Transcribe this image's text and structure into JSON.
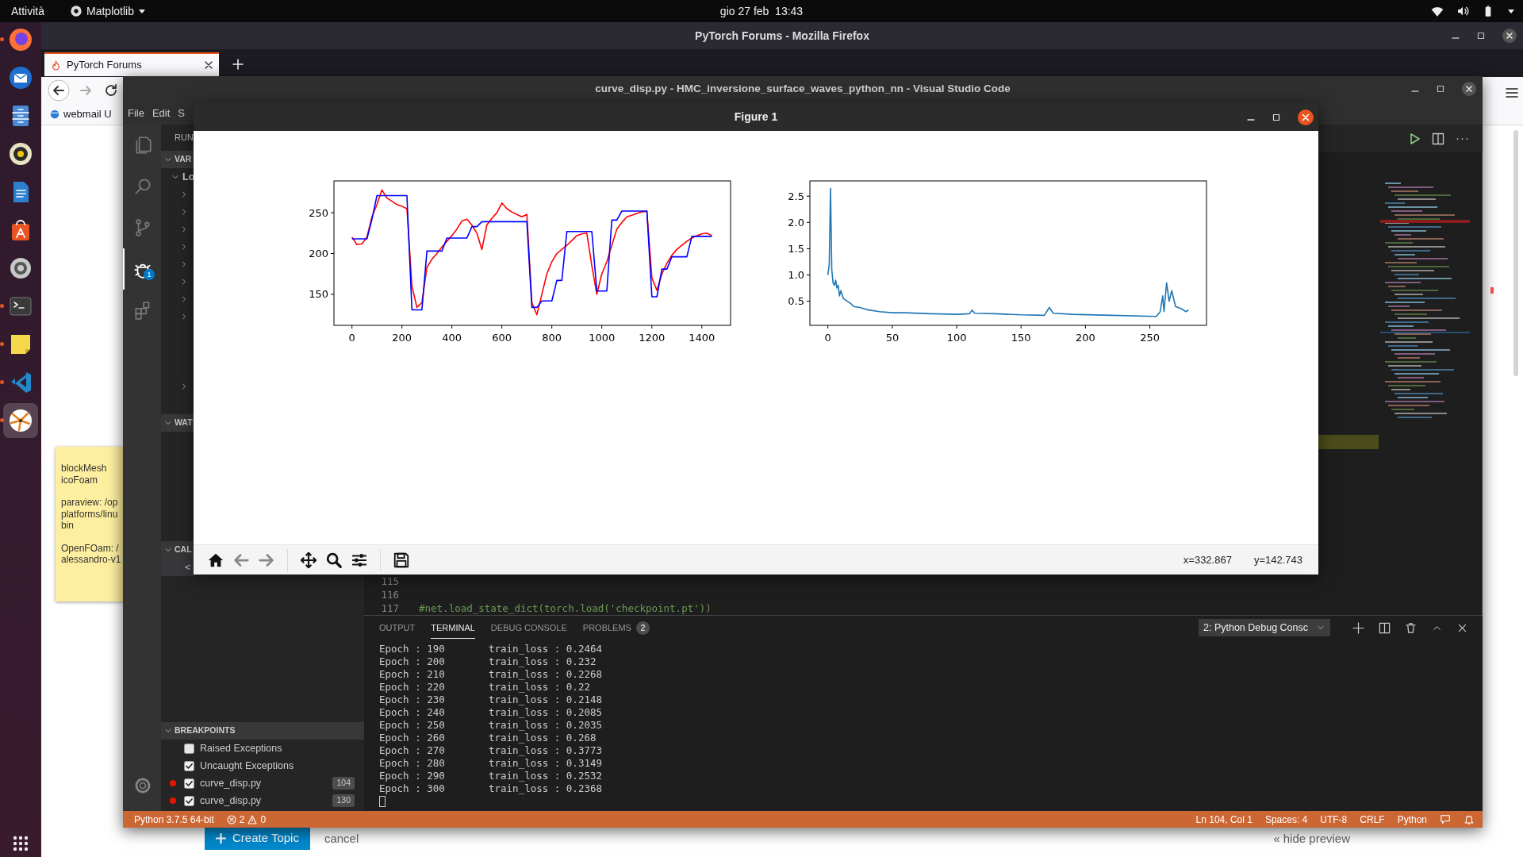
{
  "top_bar": {
    "activities": "Attività",
    "app_menu": "Matplotlib",
    "clock": "gio 27 feb  13:43"
  },
  "dock": {
    "items": [
      {
        "kind": "browser",
        "running": true,
        "selected": false
      },
      {
        "kind": "mail",
        "running": false,
        "selected": false
      },
      {
        "kind": "files",
        "running": false,
        "selected": false
      },
      {
        "kind": "music",
        "running": false,
        "selected": false
      },
      {
        "kind": "writer",
        "running": false,
        "selected": false
      },
      {
        "kind": "software",
        "running": false,
        "selected": false
      },
      {
        "kind": "settings",
        "running": false,
        "selected": false
      },
      {
        "kind": "terminal",
        "running": true,
        "selected": false
      },
      {
        "kind": "notes",
        "running": true,
        "selected": false
      },
      {
        "kind": "code",
        "running": true,
        "selected": false
      },
      {
        "kind": "plot",
        "running": true,
        "selected": true
      }
    ]
  },
  "firefox": {
    "title": "PyTorch Forums - Mozilla Firefox",
    "tabs": [
      {
        "label": "PyTorch Forums",
        "selected": true
      }
    ],
    "bookmarks": [
      "webmail U"
    ],
    "create_button": "Create Topic",
    "cancel_link": "cancel",
    "hide_preview_link": "« hide preview"
  },
  "sticky_note": {
    "paragraphs": [
      [
        "blockMesh",
        "icoFoam"
      ],
      [
        "paraview: /op",
        "platforms/linu",
        "bin"
      ],
      [
        "OpenFOam: /",
        "alessandro-v1"
      ]
    ]
  },
  "vscode": {
    "title": "curve_disp.py - HMC_inversione_surface_waves_python_nn - Visual Studio Code",
    "menu": [
      "File",
      "Edit",
      "S"
    ],
    "activity": [
      {
        "kind": "files",
        "selected": false
      },
      {
        "kind": "search",
        "selected": false
      },
      {
        "kind": "source_control",
        "selected": false
      },
      {
        "kind": "debug",
        "selected": true,
        "badge": "1"
      },
      {
        "kind": "extensions",
        "selected": false
      }
    ],
    "sidebar": {
      "run_label": "RUN",
      "variables": {
        "label": "VAR",
        "expanded": true,
        "scopes": [
          {
            "label": "Lo",
            "expanded": true,
            "children": [
              {
                "kind": "node",
                "expanded": false
              },
              {
                "kind": "node",
                "expanded": false
              },
              {
                "kind": "node",
                "expanded": false
              },
              {
                "kind": "node",
                "expanded": false
              },
              {
                "kind": "node",
                "expanded": false
              },
              {
                "kind": "node",
                "expanded": false
              },
              {
                "kind": "node",
                "expanded": false
              },
              {
                "kind": "node",
                "expanded": false
              },
              {
                "kind": "leaf"
              },
              {
                "kind": "leaf"
              },
              {
                "kind": "leaf"
              },
              {
                "kind": "node",
                "expanded": false
              }
            ]
          }
        ]
      },
      "watch": {
        "label": "WAT",
        "expanded": true
      },
      "call_stack": {
        "label": "CAL",
        "expanded": true,
        "frames": [
          "<"
        ]
      },
      "breakpoints": {
        "label": "BREAKPOINTS",
        "expanded": true,
        "items": [
          {
            "kind": "exception",
            "label": "Raised Exceptions",
            "checked": false
          },
          {
            "kind": "exception",
            "label": "Uncaught Exceptions",
            "checked": true
          },
          {
            "kind": "file",
            "label": "curve_disp.py",
            "checked": true,
            "line": "104"
          },
          {
            "kind": "file",
            "label": "curve_disp.py",
            "checked": true,
            "line": "130"
          }
        ]
      }
    },
    "editor": {
      "more": "···",
      "lines": [
        {
          "number": "115"
        },
        {
          "number": "116"
        },
        {
          "number": "117",
          "code": "#net.load_state_dict(torch.load('checkpoint.pt'))"
        }
      ]
    },
    "panel": {
      "tabs": [
        {
          "label": "OUTPUT",
          "selected": false
        },
        {
          "label": "TERMINAL",
          "selected": true
        },
        {
          "label": "DEBUG CONSOLE",
          "selected": false
        },
        {
          "label": "PROBLEMS",
          "selected": false,
          "badge": "2"
        }
      ],
      "terminal_select": "2: Python Debug Consc",
      "terminal_lines": [
        {
          "epoch": "Epoch : 190",
          "loss": "train_loss : 0.2464"
        },
        {
          "epoch": "Epoch : 200",
          "loss": "train_loss : 0.232"
        },
        {
          "epoch": "Epoch : 210",
          "loss": "train_loss : 0.2268"
        },
        {
          "epoch": "Epoch : 220",
          "loss": "train_loss : 0.22"
        },
        {
          "epoch": "Epoch : 230",
          "loss": "train_loss : 0.2148"
        },
        {
          "epoch": "Epoch : 240",
          "loss": "train_loss : 0.2085"
        },
        {
          "epoch": "Epoch : 250",
          "loss": "train_loss : 0.2035"
        },
        {
          "epoch": "Epoch : 260",
          "loss": "train_loss : 0.268"
        },
        {
          "epoch": "Epoch : 270",
          "loss": "train_loss : 0.3773"
        },
        {
          "epoch": "Epoch : 280",
          "loss": "train_loss : 0.3149"
        },
        {
          "epoch": "Epoch : 290",
          "loss": "train_loss : 0.2532"
        },
        {
          "epoch": "Epoch : 300",
          "loss": "train_loss : 0.2368"
        }
      ]
    },
    "status_bar": {
      "interpreter": "Python 3.7.5 64-bit",
      "errors": "2",
      "warnings": "0",
      "right": [
        "Ln 104, Col 1",
        "Spaces: 4",
        "UTF-8",
        "CRLF",
        "Python"
      ]
    }
  },
  "figure": {
    "title": "Figure 1",
    "x_readout": "x=332.867",
    "y_readout": "y=142.743",
    "plots": [
      {
        "chart_data": {
          "type": "line",
          "xlim": [
            -72,
            1515
          ],
          "ylim": [
            112,
            289
          ],
          "xticks": [
            0,
            200,
            400,
            600,
            800,
            1000,
            1200,
            1400
          ],
          "yticks": [
            150,
            200,
            250
          ],
          "x": [
            0,
            20,
            40,
            60,
            80,
            100,
            120,
            140,
            160,
            180,
            200,
            220,
            240,
            260,
            280,
            300,
            320,
            340,
            360,
            380,
            400,
            420,
            440,
            460,
            480,
            500,
            520,
            540,
            560,
            580,
            600,
            620,
            640,
            660,
            680,
            700,
            720,
            740,
            760,
            780,
            800,
            820,
            840,
            860,
            880,
            900,
            920,
            940,
            960,
            980,
            1000,
            1020,
            1040,
            1060,
            1080,
            1100,
            1120,
            1140,
            1160,
            1180,
            1200,
            1220,
            1240,
            1260,
            1280,
            1300,
            1320,
            1340,
            1360,
            1380,
            1400,
            1420,
            1440
          ],
          "series": [
            {
              "color": "#ff0000",
              "values": [
                220,
                211,
                212,
                220,
                245,
                260,
                278,
                268,
                264,
                260,
                258,
                255,
                160,
                134,
                140,
                183,
                193,
                200,
                208,
                215,
                222,
                230,
                240,
                242,
                235,
                225,
                205,
                235,
                243,
                250,
                262,
                255,
                251,
                248,
                245,
                248,
                140,
                125,
                150,
                175,
                190,
                200,
                205,
                210,
                216,
                222,
                224,
                225,
                185,
                150,
                175,
                190,
                210,
                230,
                238,
                245,
                247,
                249,
                251,
                252,
                170,
                155,
                175,
                188,
                198,
                205,
                210,
                215,
                219,
                222,
                224,
                225,
                222
              ]
            },
            {
              "color": "#0000ff",
              "values": [
                218,
                218,
                218,
                218,
                242,
                271,
                271,
                271,
                271,
                271,
                271,
                271,
                131,
                131,
                131,
                203,
                203,
                203,
                203,
                219,
                219,
                219,
                219,
                219,
                233,
                233,
                239,
                239,
                239,
                239,
                239,
                239,
                239,
                239,
                239,
                239,
                134,
                134,
                142,
                142,
                142,
                167,
                167,
                227,
                227,
                227,
                227,
                227,
                227,
                154,
                154,
                154,
                241,
                241,
                252,
                252,
                252,
                252,
                252,
                252,
                147,
                147,
                181,
                181,
                196,
                196,
                196,
                196,
                221,
                221,
                221,
                221,
                221
              ]
            }
          ]
        }
      },
      {
        "chart_data": {
          "type": "line",
          "xlim": [
            -14,
            294
          ],
          "ylim": [
            0.04,
            2.79
          ],
          "xticks": [
            0,
            50,
            100,
            150,
            200,
            250
          ],
          "yticks": [
            {
              "value": 0.5,
              "label": "0.5"
            },
            {
              "value": 1,
              "label": "1.0"
            },
            {
              "value": 1.5,
              "label": "1.5"
            },
            {
              "value": 2,
              "label": "2.0"
            },
            {
              "value": 2.5,
              "label": "2.5"
            }
          ],
          "x": [
            0,
            1,
            2,
            3,
            4,
            5,
            6,
            7,
            8,
            9,
            10,
            12,
            15,
            18,
            20,
            25,
            30,
            40,
            50,
            60,
            80,
            100,
            110,
            112,
            114,
            130,
            150,
            168,
            172,
            175,
            190,
            220,
            255,
            258,
            260,
            261,
            263,
            265,
            267,
            270,
            275,
            278,
            280
          ],
          "series": [
            {
              "color": "#1f77b4",
              "values": [
                1.0,
                1.2,
                2.65,
                1.1,
                0.85,
                0.8,
                0.9,
                0.75,
                0.8,
                0.6,
                0.7,
                0.55,
                0.5,
                0.45,
                0.4,
                0.38,
                0.34,
                0.3,
                0.28,
                0.28,
                0.26,
                0.25,
                0.26,
                0.33,
                0.27,
                0.26,
                0.24,
                0.23,
                0.38,
                0.27,
                0.25,
                0.23,
                0.21,
                0.3,
                0.6,
                0.3,
                0.85,
                0.5,
                0.7,
                0.4,
                0.35,
                0.3,
                0.33
              ]
            }
          ]
        }
      }
    ]
  }
}
